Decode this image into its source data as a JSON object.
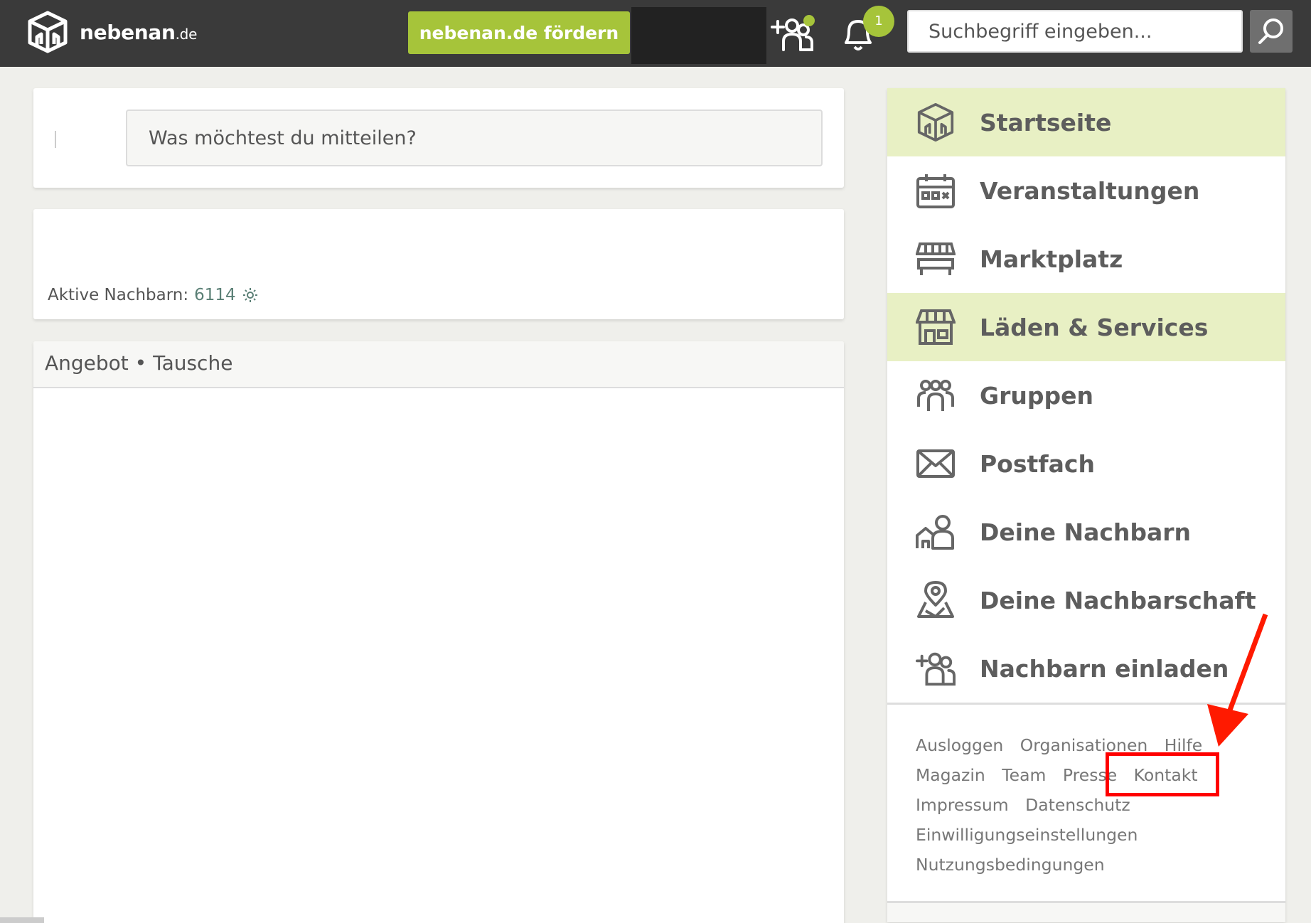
{
  "header": {
    "logo_text": "nebenan",
    "logo_suffix": ".de",
    "donate_label": "nebenan.de fördern",
    "notification_count": "1",
    "search_placeholder": "Suchbegriff eingeben..."
  },
  "compose": {
    "placeholder": "Was möchtest du mitteilen?"
  },
  "stats": {
    "label": "Aktive Nachbarn:",
    "value": "6114"
  },
  "feed": {
    "heading": "Angebot • Tausche"
  },
  "nav": {
    "items": [
      {
        "label": "Startseite",
        "icon": "home-icon",
        "active": true
      },
      {
        "label": "Veranstaltungen",
        "icon": "calendar-icon",
        "active": false
      },
      {
        "label": "Marktplatz",
        "icon": "market-stall-icon",
        "active": false
      },
      {
        "label": "Läden & Services",
        "icon": "shop-icon",
        "active": true
      },
      {
        "label": "Gruppen",
        "icon": "group-icon",
        "active": false
      },
      {
        "label": "Postfach",
        "icon": "envelope-icon",
        "active": false
      },
      {
        "label": "Deine Nachbarn",
        "icon": "neighbors-icon",
        "active": false
      },
      {
        "label": "Deine Nachbarschaft",
        "icon": "map-pin-icon",
        "active": false
      },
      {
        "label": "Nachbarn einladen",
        "icon": "invite-icon",
        "active": false
      }
    ]
  },
  "footer_links": {
    "row1": [
      "Ausloggen",
      "Organisationen",
      "Hilfe"
    ],
    "row2": [
      "Magazin",
      "Team",
      "Presse",
      "Kontakt"
    ],
    "row3": [
      "Impressum",
      "Datenschutz"
    ],
    "row4": [
      "Einwilligungseinstellungen"
    ],
    "row5": [
      "Nutzungsbedingungen"
    ]
  },
  "colors": {
    "header_bg": "#3a3a3a",
    "accent_green": "#a6c43a",
    "active_bg": "#e8f0c4",
    "annotation_red": "#ff0000"
  }
}
